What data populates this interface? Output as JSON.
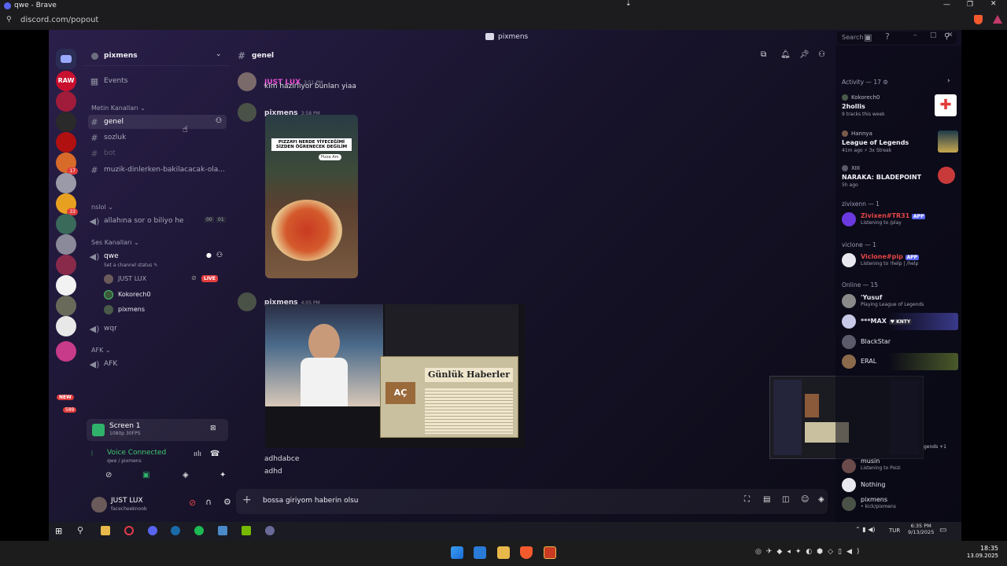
{
  "browser": {
    "window_title": "qwe - Brave",
    "url": "discord.com/popout"
  },
  "app": {
    "title": "pixmens"
  },
  "server": {
    "name": "pixmens",
    "events_label": "Events"
  },
  "servers": [
    {
      "label": "RAW",
      "badge": ""
    },
    {
      "label": "",
      "badge": ""
    },
    {
      "label": "",
      "badge": ""
    },
    {
      "label": "",
      "badge": ""
    },
    {
      "label": "",
      "badge": "17"
    },
    {
      "label": "",
      "badge": ""
    },
    {
      "label": "",
      "badge": "33"
    },
    {
      "label": "",
      "badge": ""
    },
    {
      "label": "",
      "badge": ""
    },
    {
      "label": "",
      "badge": ""
    },
    {
      "label": "",
      "badge": ""
    },
    {
      "label": "",
      "badge": ""
    },
    {
      "label": "",
      "badge": ""
    },
    {
      "label": "",
      "badge": ""
    }
  ],
  "new_badge": "NEW",
  "new_count": "589",
  "channels": {
    "cat1": "Metin Kanalları",
    "text": [
      "genel",
      "sozluk",
      "bot",
      "muzik-dinlerken-bakilacacak-ola..."
    ],
    "cat2": "nslol",
    "voice1": "allahına sor o biliyo he",
    "voice1_tags": [
      "00",
      "01"
    ],
    "cat3": "Ses Kanalları",
    "voice2": "qwe",
    "voice2_status": "Set a channel status",
    "voice_users": [
      "JUST LUX",
      "Kokorech0",
      "pixmens"
    ],
    "live": "LIVE",
    "voice3": "wqr",
    "cat4": "AFK",
    "voice4": "AFK"
  },
  "stream_panel": {
    "title": "Screen 1",
    "sub": "1080p 30FPS"
  },
  "voice_panel": {
    "status": "Voice Connected",
    "location": "qwe / pixmens"
  },
  "user_panel": {
    "name": "JUST LUX",
    "status": "facecheeknoob"
  },
  "header": {
    "channel": "genel",
    "search_placeholder": "Search"
  },
  "messages": [
    {
      "author": "JUST LUX",
      "time": "3:51 PM",
      "text": "kim hazırlıyor bunları yiaa",
      "color": "#e34fd0"
    },
    {
      "author": "pixmens",
      "time": "3:58 PM",
      "text": "",
      "color": "#dcdde3"
    },
    {
      "author": "pixmens",
      "time": "4:05 PM",
      "text": "",
      "color": "#dcdde3"
    }
  ],
  "image1": {
    "caption": "PIZZAYI NERDE YİYECEĞİMİ SİZDEN ÖĞRENECEK DEĞİLİM",
    "tag": "Pizza Am"
  },
  "image2": {
    "news_title": "Günlük Haberler",
    "button": "AÇ"
  },
  "trailing_lines": [
    "adhdabce",
    "adhd"
  ],
  "composer": {
    "value": "bossa giriyom haberin olsu"
  },
  "activity": {
    "header": "Activity — 17",
    "items": [
      {
        "user": "Kokorech0",
        "game": "2hollis",
        "sub": "9 tracks this week"
      },
      {
        "user": "Hannya",
        "game": "League of Legends",
        "sub": "41m ago  ⚡ 3x Streak"
      },
      {
        "user": "XIII",
        "game": "NARAKA: BLADEPOINT",
        "sub": "5h ago"
      }
    ]
  },
  "member_sections": [
    {
      "title": "zivixenn — 1",
      "members": [
        {
          "name": "Zivixen#TR31",
          "tag": "APP",
          "sub": "Listening to /play",
          "color": "#e34646"
        }
      ]
    },
    {
      "title": "viclone — 1",
      "members": [
        {
          "name": "Viclone#pip",
          "tag": "APP",
          "sub": "Listening to !help | /help",
          "color": "#e34646"
        }
      ]
    },
    {
      "title": "Online — 15",
      "members": [
        {
          "name": "'Yusuf",
          "sub": "Playing League of Legends",
          "color": "#e4e4ee"
        },
        {
          "name": "***MAX",
          "tag": "KNTY",
          "sub": "",
          "color": "#e4e4ee"
        },
        {
          "name": "BlackStar",
          "sub": "",
          "color": "#e4e4ee"
        },
        {
          "name": "ERAL",
          "sub": "",
          "color": "#e4e4ee"
        }
      ]
    }
  ],
  "bottom_members": [
    {
      "name": "musin",
      "sub": "Listening to Poizi"
    },
    {
      "name": "Nothing",
      "sub": ""
    },
    {
      "name": "pixmens",
      "sub": "kick/pixmens"
    }
  ],
  "overlay_text": "gends +1",
  "inner_tray": {
    "lang": "TUR",
    "time": "6:35 PM",
    "date": "9/13/2025"
  },
  "tray": {
    "time": "18:35",
    "date": "13.09.2025"
  }
}
